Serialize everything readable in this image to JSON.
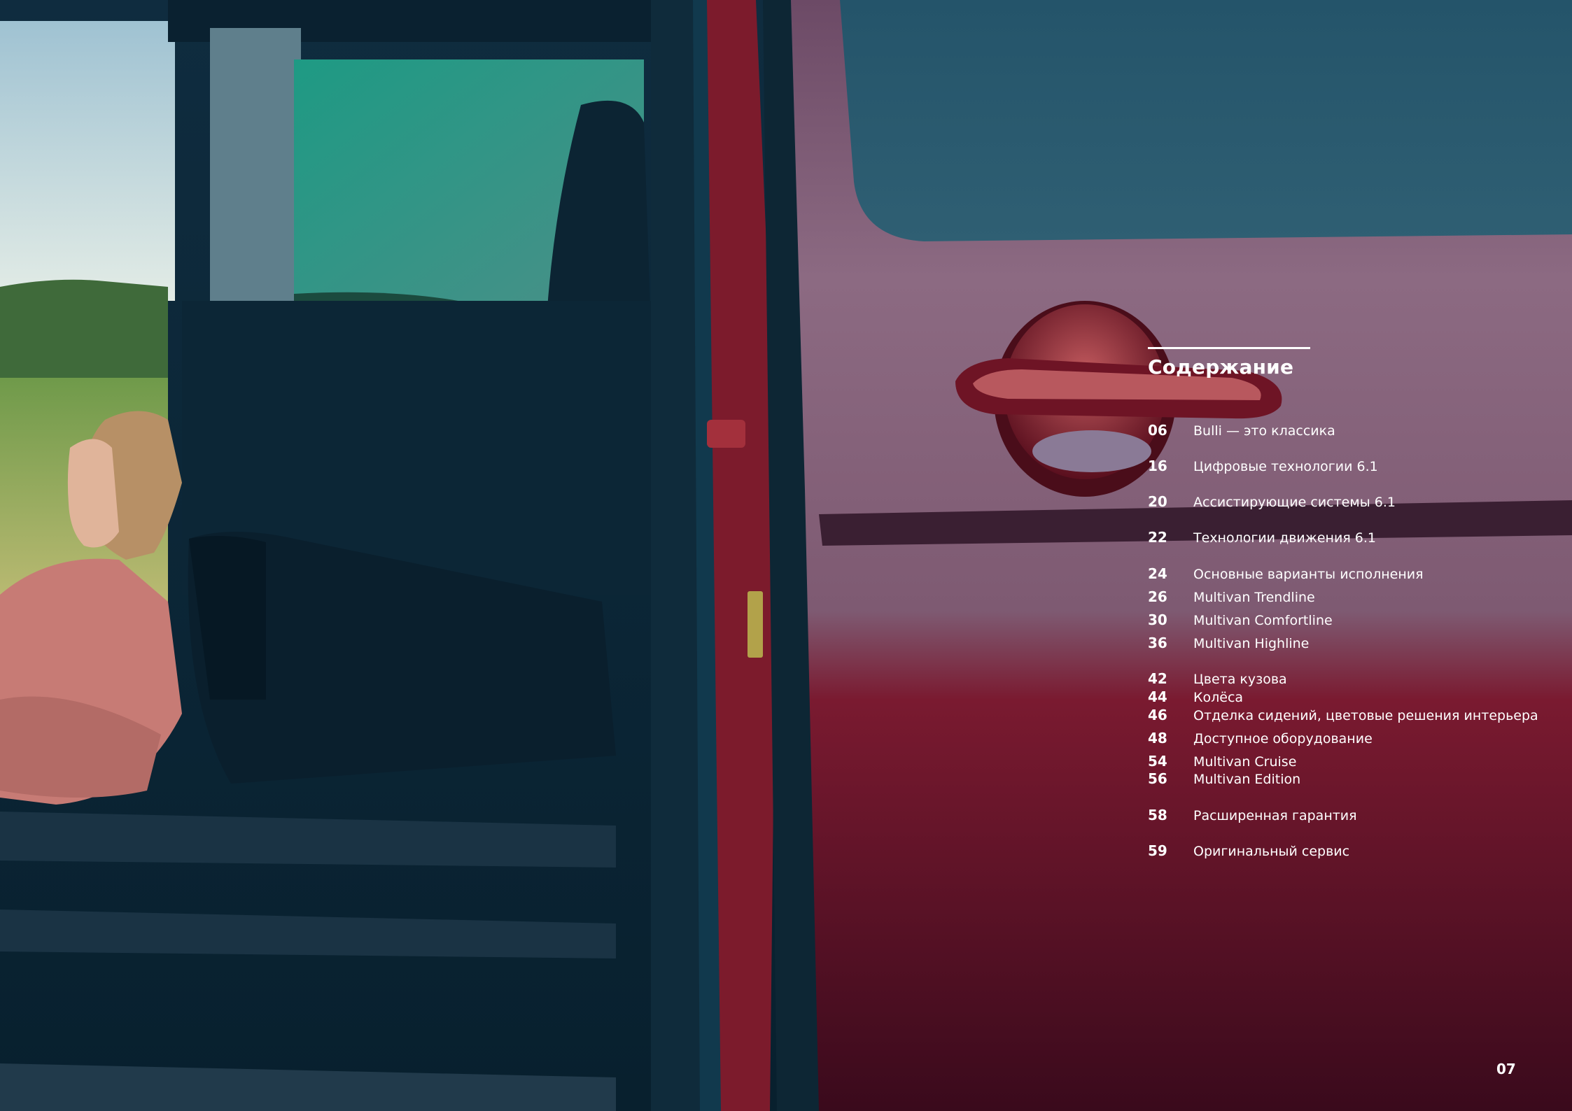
{
  "toc": {
    "title": "Содержание",
    "items": [
      {
        "page": "06",
        "label": "Bulli — это классика"
      },
      {
        "page": "16",
        "label": "Цифровые технологии 6.1"
      },
      {
        "page": "20",
        "label": "Ассистирующие системы 6.1"
      },
      {
        "page": "22",
        "label": "Технологии движения 6.1"
      },
      {
        "page": "24",
        "label": "Основные варианты исполнения"
      },
      {
        "page": "26",
        "label": "Multivan Trendline"
      },
      {
        "page": "30",
        "label": "Multivan Comfortline"
      },
      {
        "page": "36",
        "label": "Multivan Highline"
      },
      {
        "page": "42",
        "label": "Цвета кузова"
      },
      {
        "page": "44",
        "label": "Колёса"
      },
      {
        "page": "46",
        "label": "Отделка сидений, цветовые решения интерьера"
      },
      {
        "page": "48",
        "label": "Доступное оборудование"
      },
      {
        "page": "54",
        "label": "Multivan Cruise"
      },
      {
        "page": "56",
        "label": "Multivan Edition"
      },
      {
        "page": "58",
        "label": "Расширенная гарантия"
      },
      {
        "page": "59",
        "label": "Оригинальный сервис"
      }
    ]
  },
  "page_number": "07",
  "colors": {
    "van_body": "#7a1628",
    "van_panel": "#8a6a80",
    "window_glass": "#2a5a6e",
    "cabin_dark": "#0b2232",
    "sky": "#cfe0ea",
    "hoodie": "#c87a74",
    "text": "#ffffff"
  }
}
